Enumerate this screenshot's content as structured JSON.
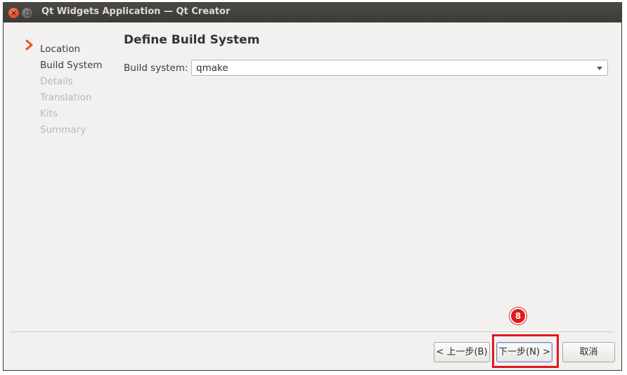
{
  "window": {
    "title": "Qt Widgets Application — Qt Creator",
    "close_glyph": "×"
  },
  "sidebar": {
    "steps": [
      {
        "label": "Location",
        "state": "done"
      },
      {
        "label": "Build System",
        "state": "current"
      },
      {
        "label": "Details",
        "state": "pending"
      },
      {
        "label": "Translation",
        "state": "pending"
      },
      {
        "label": "Kits",
        "state": "pending"
      },
      {
        "label": "Summary",
        "state": "pending"
      }
    ],
    "current_marker_icon": "chevron-right-icon",
    "marker_color": "#e95420"
  },
  "main": {
    "title": "Define Build System",
    "build_system_label": "Build system:",
    "build_system_value": "qmake"
  },
  "buttons": {
    "back": "< 上一步(B)",
    "next": "下一步(N) >",
    "cancel": "取消"
  },
  "annotation": {
    "badge_number": "8",
    "highlight_color": "#e0191c"
  }
}
